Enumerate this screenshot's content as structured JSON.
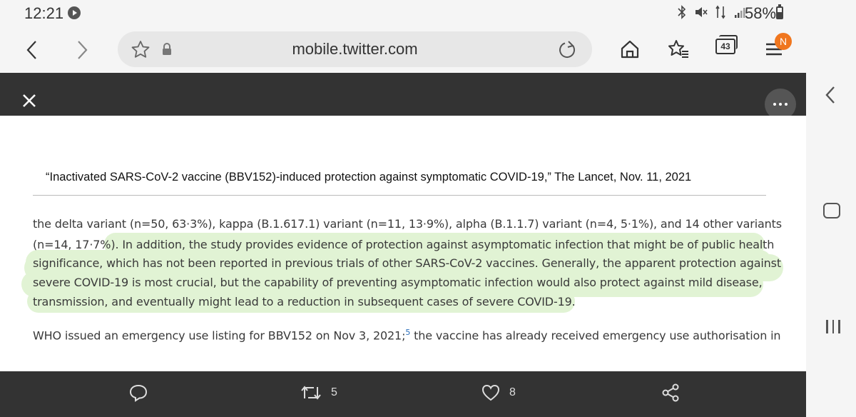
{
  "status_bar": {
    "time": "12:21",
    "battery": "58%"
  },
  "browser": {
    "url": "mobile.twitter.com",
    "tab_count": "43",
    "menu_badge": "N"
  },
  "document": {
    "title": "“Inactivated SARS-CoV-2 vaccine (BBV152)-induced protection against symptomatic COVID-19,” The Lancet, Nov. 11, 2021",
    "lines": [
      "the delta variant (n=50, 63·3%), kappa (B.1.617.1) variant (n=11, 13·9%), alpha (B.1.1.7) variant (n=4, 5·1%), and 14 other variants",
      "(n=14, 17·7%). In addition, the study provides evidence of protection against asymptomatic infection that might be of public health",
      "significance, which has not been reported in previous trials of other SARS-CoV-2 vaccines. Generally, the apparent protection against",
      "severe COVID-19 is most crucial, but the capability of preventing asymptomatic infection would also protect against mild disease,",
      "transmission, and eventually might lead to a reduction in subsequent cases of severe COVID-19."
    ],
    "last_line_pre": "WHO issued an emergency use listing for BBV152 on Nov 3, 2021;",
    "last_line_ref": "5",
    "last_line_post": " the vaccine has already received emergency use authorisation in"
  },
  "actions": {
    "retweets": "5",
    "likes": "8"
  },
  "colors": {
    "highlight": "#e1f3d4",
    "viewer_bar": "#333333",
    "badge": "#f0761e"
  }
}
